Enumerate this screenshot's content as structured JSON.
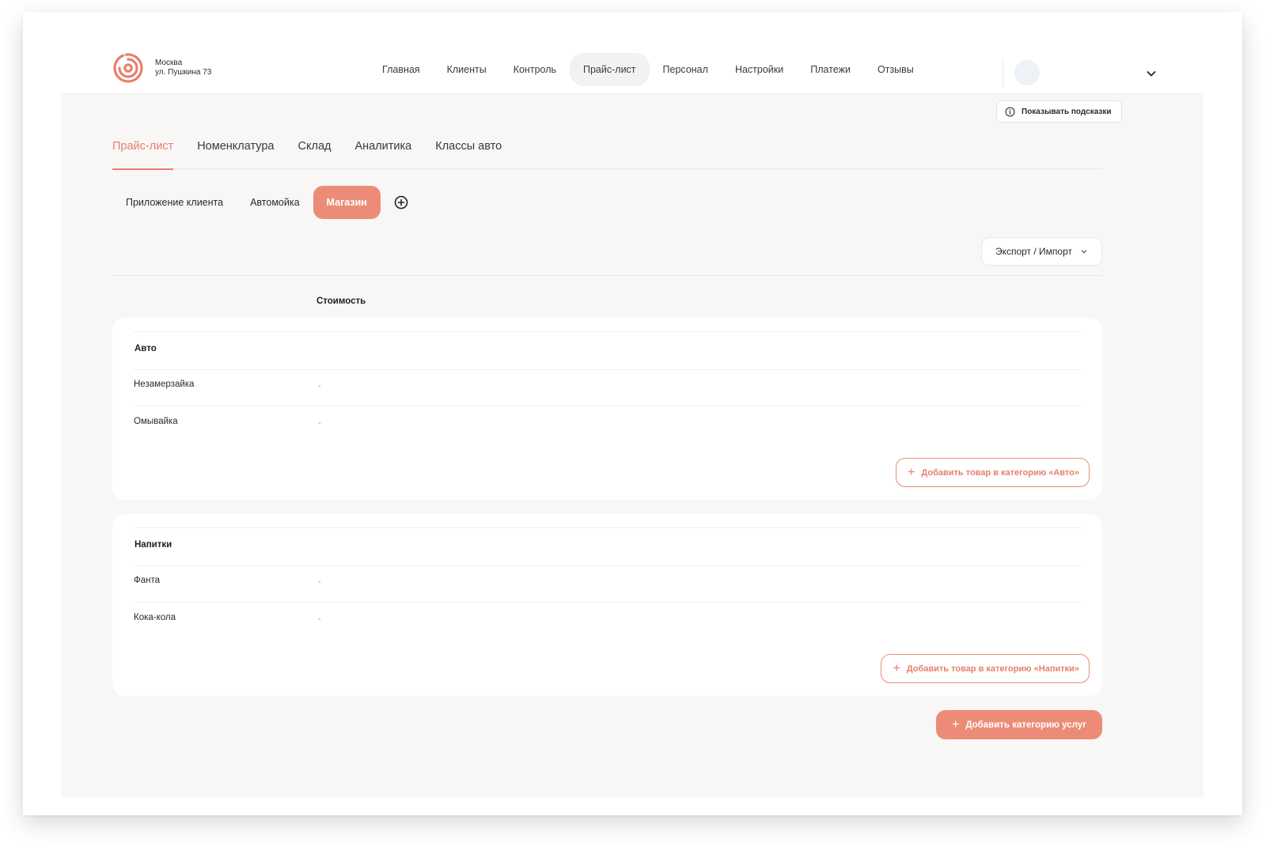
{
  "colors": {
    "accent": "#e77f6c",
    "accent_fill": "#ec8c78",
    "background": "#f8f7f6"
  },
  "header": {
    "location_city": "Москва",
    "location_address": "ул. Пушкина 73",
    "nav": [
      {
        "label": "Главная"
      },
      {
        "label": "Клиенты"
      },
      {
        "label": "Контроль"
      },
      {
        "label": "Прайс-лист",
        "active": true
      },
      {
        "label": "Персонал"
      },
      {
        "label": "Настройки"
      },
      {
        "label": "Платежи"
      },
      {
        "label": "Отзывы"
      }
    ]
  },
  "hints_label": "Показывать подсказки",
  "tabs": [
    {
      "label": "Прайс-лист",
      "active": true
    },
    {
      "label": "Номенклатура"
    },
    {
      "label": "Склад"
    },
    {
      "label": "Аналитика"
    },
    {
      "label": "Классы авто"
    }
  ],
  "chips": [
    {
      "label": "Приложение клиента"
    },
    {
      "label": "Автомойка"
    },
    {
      "label": "Магазин",
      "active": true
    }
  ],
  "export_label": "Экспорт / Импорт",
  "column_header": "Стоимость",
  "categories": [
    {
      "title": "Авто",
      "items": [
        {
          "name": "Незамерзайка",
          "price": "-"
        },
        {
          "name": "Омывайка",
          "price": "-"
        }
      ],
      "add_button": "Добавить товар в категорию «Авто»"
    },
    {
      "title": "Напитки",
      "items": [
        {
          "name": "Фанта",
          "price": "-"
        },
        {
          "name": "Кока-кола",
          "price": "-"
        }
      ],
      "add_button": "Добавить товар в категорию «Напитки»"
    }
  ],
  "add_category_label": "Добавить категорию услуг",
  "icons": {
    "logo": "logo-icon",
    "info": "info-icon",
    "add": "plus-circle-icon",
    "chevron": "chevron-down-icon"
  }
}
